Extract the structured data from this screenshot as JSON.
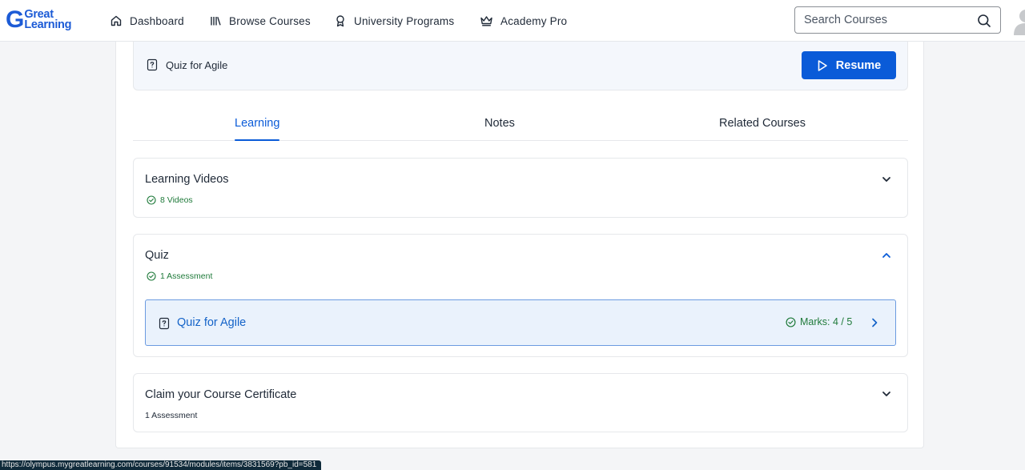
{
  "brand": {
    "logo_letter": "G",
    "logo_line1": "Great",
    "logo_line2": "Learning",
    "color": "#1c5bd6"
  },
  "nav": {
    "items": [
      {
        "label": "Dashboard",
        "icon": "home-icon"
      },
      {
        "label": "Browse Courses",
        "icon": "library-icon"
      },
      {
        "label": "University Programs",
        "icon": "award-icon"
      },
      {
        "label": "Academy Pro",
        "icon": "crown-icon"
      }
    ],
    "search_placeholder": "Search Courses"
  },
  "resume_bar": {
    "item_title": "Quiz for Agile",
    "button_label": "Resume"
  },
  "tabs": [
    {
      "label": "Learning",
      "active": true
    },
    {
      "label": "Notes",
      "active": false
    },
    {
      "label": "Related Courses",
      "active": false
    }
  ],
  "sections": {
    "videos": {
      "title": "Learning Videos",
      "subtitle": "8 Videos",
      "expanded": false
    },
    "quiz": {
      "title": "Quiz",
      "subtitle": "1 Assessment",
      "expanded": true,
      "item": {
        "title": "Quiz for Agile",
        "marks": "Marks: 4 / 5"
      }
    },
    "certificate": {
      "title": "Claim your Course Certificate",
      "subtitle": "1 Assessment",
      "expanded": false
    }
  },
  "status_bar_url": "https://olympus.mygreatlearning.com/courses/91534/modules/items/3831569?pb_id=581",
  "colors": {
    "accent": "#0a5bd8",
    "success": "#1f7a3a",
    "quiz_item_bg": "#eaf2fc"
  }
}
